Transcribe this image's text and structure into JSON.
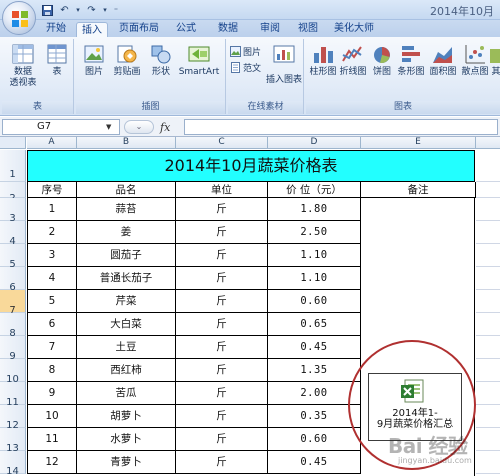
{
  "window": {
    "title": "2014年10月"
  },
  "ribbon": {
    "tabs": [
      "开始",
      "插入",
      "页面布局",
      "公式",
      "数据",
      "审阅",
      "视图",
      "美化大师"
    ],
    "active_tab": "插入",
    "groups": {
      "tables": {
        "label": "表",
        "pivot_label_1": "数据",
        "pivot_label_2": "透视表",
        "table_label": "表"
      },
      "illustrations": {
        "label": "插图",
        "picture": "图片",
        "clipart": "剪贴画",
        "shapes": "形状",
        "smartart": "SmartArt"
      },
      "online": {
        "label": "在线素材",
        "picture": "图片",
        "fanwen": "范文",
        "insert_chart": "插入图表"
      },
      "charts": {
        "label": "图表",
        "column": "柱形图",
        "line": "折线图",
        "pie": "饼图",
        "bar": "条形图",
        "area": "面积图",
        "scatter": "散点图",
        "other": "其"
      }
    }
  },
  "formula_bar": {
    "name_box": "G7",
    "fx": "fx",
    "formula": ""
  },
  "sheet": {
    "columns": [
      "A",
      "B",
      "C",
      "D",
      "E"
    ],
    "rows": [
      "1",
      "2",
      "3",
      "4",
      "5",
      "6",
      "7",
      "8",
      "9",
      "10",
      "11",
      "12",
      "13",
      "14"
    ],
    "selected_row": "7",
    "title": "2014年10月蔬菜价格表",
    "headers": {
      "no": "序号",
      "name": "品名",
      "unit": "单位",
      "price": "价 位（元）",
      "note": "备注"
    },
    "data_rows": [
      {
        "no": "1",
        "name": "蒜苔",
        "unit": "斤",
        "price": "1.80"
      },
      {
        "no": "2",
        "name": "姜",
        "unit": "斤",
        "price": "2.50"
      },
      {
        "no": "3",
        "name": "圆茄子",
        "unit": "斤",
        "price": "1.10"
      },
      {
        "no": "4",
        "name": "普通长茄子",
        "unit": "斤",
        "price": "1.10"
      },
      {
        "no": "5",
        "name": "芹菜",
        "unit": "斤",
        "price": "0.60"
      },
      {
        "no": "6",
        "name": "大白菜",
        "unit": "斤",
        "price": "0.65"
      },
      {
        "no": "7",
        "name": "土豆",
        "unit": "斤",
        "price": "0.45"
      },
      {
        "no": "8",
        "name": "西红柿",
        "unit": "斤",
        "price": "1.35"
      },
      {
        "no": "9",
        "name": "苦瓜",
        "unit": "斤",
        "price": "2.00"
      },
      {
        "no": "10",
        "name": "胡萝卜",
        "unit": "斤",
        "price": "0.35"
      },
      {
        "no": "11",
        "name": "水萝卜",
        "unit": "斤",
        "price": "0.60"
      },
      {
        "no": "12",
        "name": "青萝卜",
        "unit": "斤",
        "price": "0.45"
      }
    ],
    "embedded_object": {
      "label_line1": "2014年1-",
      "label_line2": "9月蔬菜价格汇总"
    }
  },
  "watermark": {
    "text": "Bai 经验",
    "sub": "jingyan.baidu.com"
  },
  "colors": {
    "title_fill": "#22ffff",
    "circle": "#b03030",
    "selected_row": "#f9d99a"
  }
}
